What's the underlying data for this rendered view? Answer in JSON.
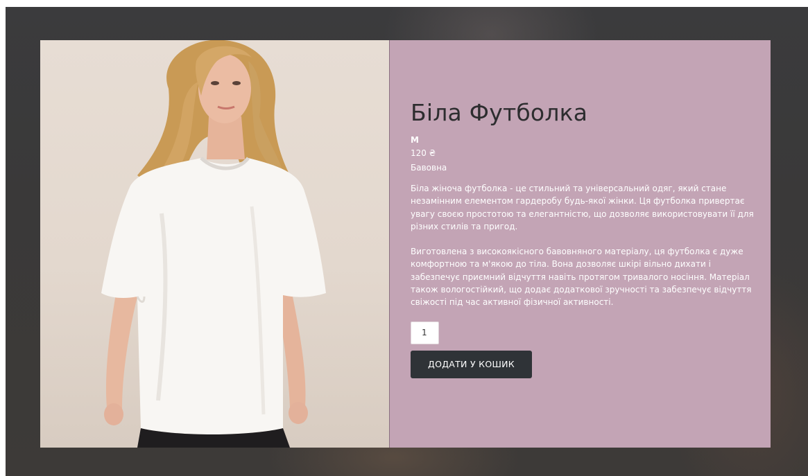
{
  "product": {
    "title": "Біла Футболка",
    "size": "М",
    "price": "120 ₴",
    "material": "Бавовна",
    "description": [
      "Біла жіноча футболка - це стильний та універсальний одяг, який стане незамінним елементом гардеробу будь-якої жінки. Ця футболка привертає увагу своєю простотою та елегантністю, що дозволяє використовувати її для різних стилів та пригод.",
      "Виготовлена з високоякісного бавовняного матеріалу, ця футболка є дуже комфортною та м'якою до тіла. Вона дозволяє шкірі вільно дихати і забезпечує приємний відчуття навіть протягом тривалого носіння. Матеріал також вологостійкий, що додає додаткової зручності та забезпечує відчуття свіжості під час активної фізичної активності."
    ],
    "quantity": "1",
    "add_to_cart_label": "ДОДАТИ У КОШИК"
  },
  "colors": {
    "panel": "#c3a4b5",
    "button": "#2f3337",
    "title": "#2d2d2f",
    "page_background": "#3b3b3d"
  }
}
